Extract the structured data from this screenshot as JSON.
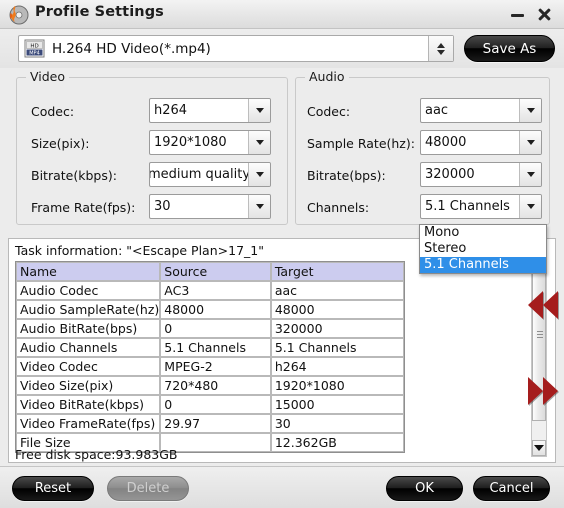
{
  "window": {
    "title": "Profile Settings",
    "icon": "disc-flame-icon",
    "minimize_label": "minimize-icon",
    "close_label": "close-icon"
  },
  "profile": {
    "icon": "mp4-hd-file-icon",
    "value": "H.264 HD Video(*.mp4)",
    "spinner": "spinner-up-down-icon",
    "save_as_label": "Save As"
  },
  "video": {
    "legend": "Video",
    "fields": [
      {
        "label": "Codec:",
        "value": "h264"
      },
      {
        "label": "Size(pix):",
        "value": "1920*1080"
      },
      {
        "label": "Bitrate(kbps):",
        "value": "medium quality"
      },
      {
        "label": "Frame Rate(fps):",
        "value": "30"
      }
    ]
  },
  "audio": {
    "legend": "Audio",
    "fields": [
      {
        "label": "Codec:",
        "value": "aac"
      },
      {
        "label": "Sample Rate(hz):",
        "value": "48000"
      },
      {
        "label": "Bitrate(bps):",
        "value": "320000"
      },
      {
        "label": "Channels:",
        "value": "5.1 Channels"
      }
    ],
    "channels_dropdown": {
      "open": true,
      "options": [
        "Mono",
        "Stereo",
        "5.1 Channels"
      ],
      "selected": "5.1 Channels",
      "highlight_color": "#2f8fe8"
    }
  },
  "task": {
    "title": "Task information: \"<Escape Plan>17_1\"",
    "columns": [
      "Name",
      "Source",
      "Target"
    ],
    "header_bg": "#ccccef",
    "rows": [
      {
        "name": "Audio Codec",
        "source": "AC3",
        "target": "aac"
      },
      {
        "name": "Audio SampleRate(hz)",
        "source": "48000",
        "target": "48000"
      },
      {
        "name": "Audio BitRate(bps)",
        "source": "0",
        "target": "320000"
      },
      {
        "name": "Audio Channels",
        "source": "5.1 Channels",
        "target": "5.1 Channels"
      },
      {
        "name": "Video Codec",
        "source": "MPEG-2",
        "target": "h264"
      },
      {
        "name": "Video Size(pix)",
        "source": "720*480",
        "target": "1920*1080"
      },
      {
        "name": "Video BitRate(kbps)",
        "source": "0",
        "target": "15000"
      },
      {
        "name": "Video FrameRate(fps)",
        "source": "29.97",
        "target": "30"
      },
      {
        "name": "File Size",
        "source": "",
        "target": "12.362GB"
      }
    ],
    "free_space": "Free disk space:93.983GB",
    "scrollbar": "vertical-scrollbar"
  },
  "nav": {
    "prev": "rewind-double-arrow-icon",
    "next": "forward-double-arrow-icon",
    "color": "#a51d1d"
  },
  "footer": {
    "reset_label": "Reset",
    "delete_label": "Delete",
    "delete_disabled": true,
    "ok_label": "OK",
    "cancel_label": "Cancel"
  }
}
